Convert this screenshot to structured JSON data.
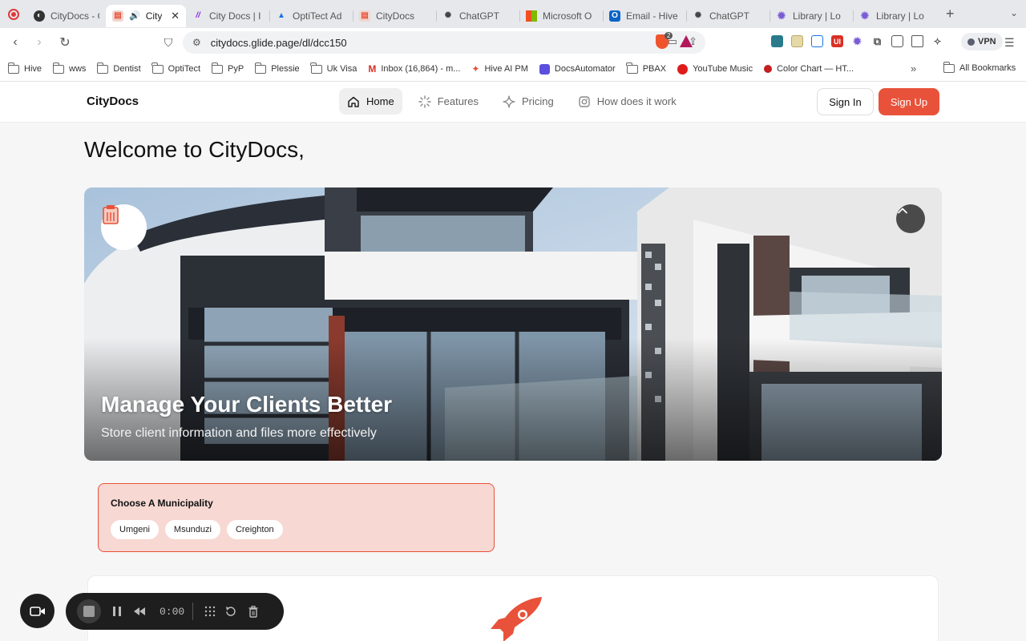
{
  "browser": {
    "tabs": [
      {
        "title": "CityDocs - G",
        "favicon": "compass-icon",
        "active": false
      },
      {
        "title": "CityD",
        "favicon": "citydocs-icon",
        "active": true,
        "audio": true
      },
      {
        "title": "City Docs | I",
        "favicon": "make-icon",
        "active": false
      },
      {
        "title": "OptiTect Ad",
        "favicon": "drive-icon",
        "active": false
      },
      {
        "title": "CityDocs",
        "favicon": "citydocs-icon",
        "active": false
      },
      {
        "title": "ChatGPT",
        "favicon": "openai-icon",
        "active": false
      },
      {
        "title": "Microsoft O",
        "favicon": "microsoft-icon",
        "active": false
      },
      {
        "title": "Email - Hive",
        "favicon": "outlook-icon",
        "active": false
      },
      {
        "title": "ChatGPT",
        "favicon": "openai-icon",
        "active": false
      },
      {
        "title": "Library | Lo",
        "favicon": "library-icon",
        "active": false
      },
      {
        "title": "Library | Lo",
        "favicon": "library-icon",
        "active": false
      }
    ],
    "url": "citydocs.glide.page/dl/dcc150",
    "brave_badge": "2",
    "vpn_label": "VPN",
    "bookmarks": [
      {
        "label": "Hive",
        "icon": "folder-icon"
      },
      {
        "label": "wws",
        "icon": "folder-icon"
      },
      {
        "label": "Dentist",
        "icon": "folder-icon"
      },
      {
        "label": "OptiTect",
        "icon": "folder-icon"
      },
      {
        "label": "PyP",
        "icon": "folder-icon"
      },
      {
        "label": "Plessie",
        "icon": "folder-icon"
      },
      {
        "label": "Uk Visa",
        "icon": "folder-icon"
      },
      {
        "label": "Inbox (16,864) - m...",
        "icon": "gmail-icon"
      },
      {
        "label": "Hive AI PM",
        "icon": "hive-icon"
      },
      {
        "label": "DocsAutomator",
        "icon": "docsautomator-icon"
      },
      {
        "label": "PBAX",
        "icon": "folder-icon"
      },
      {
        "label": "YouTube Music",
        "icon": "youtube-music-icon"
      },
      {
        "label": "Color Chart — HT...",
        "icon": "color-chart-icon"
      }
    ],
    "bookmarks_more": "»",
    "all_bookmarks": "All Bookmarks"
  },
  "site": {
    "brand": "CityDocs",
    "nav": [
      {
        "label": "Home",
        "icon": "home-icon",
        "active": true
      },
      {
        "label": "Features",
        "icon": "sparkle-icon",
        "active": false
      },
      {
        "label": "Pricing",
        "icon": "star-icon",
        "active": false
      },
      {
        "label": "How does it work",
        "icon": "instagram-icon",
        "active": false
      }
    ],
    "sign_in": "Sign In",
    "sign_up": "Sign Up",
    "welcome": "Welcome to CityDocs,",
    "hero": {
      "title": "Manage Your Clients Better",
      "subtitle": "Store client information and files more effectively"
    },
    "municipality": {
      "title": "Choose A Municipality",
      "options": [
        "Umgeni",
        "Msunduzi",
        "Creighton"
      ]
    }
  },
  "recorder": {
    "time": "0:00"
  },
  "colors": {
    "accent": "#e8523a",
    "accent_light": "#f7d8d2",
    "recorder_bg": "#1e1e1e"
  }
}
